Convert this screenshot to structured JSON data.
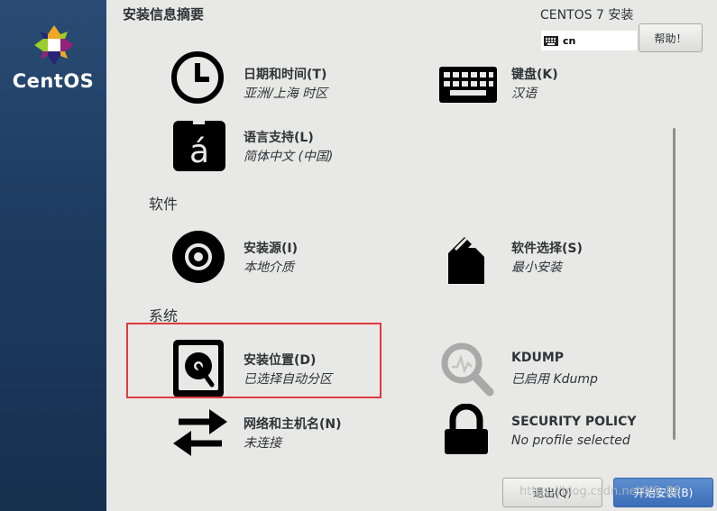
{
  "sidebar": {
    "brand": "CentOS"
  },
  "header": {
    "title": "安装信息摘要",
    "product": "CENTOS 7 安装",
    "keyboard_layout": "cn",
    "help_label": "帮助！"
  },
  "sections": {
    "software": "软件",
    "system": "系统"
  },
  "spokes": {
    "datetime": {
      "title": "日期和时间(T)",
      "status": "亚洲/上海 时区"
    },
    "keyboard": {
      "title": "键盘(K)",
      "status": "汉语"
    },
    "language": {
      "title": "语言支持(L)",
      "status": "简体中文 (中国)"
    },
    "source": {
      "title": "安装源(I)",
      "status": "本地介质"
    },
    "software": {
      "title": "软件选择(S)",
      "status": "最小安装"
    },
    "destination": {
      "title": "安装位置(D)",
      "status": "已选择自动分区"
    },
    "kdump": {
      "title": "KDUMP",
      "status": "已启用 Kdump"
    },
    "network": {
      "title": "网络和主机名(N)",
      "status": "未连接"
    },
    "security": {
      "title": "SECURITY POLICY",
      "status": "No profile selected"
    }
  },
  "footer": {
    "quit_label": "退出(Q)",
    "begin_label": "开始安装(B)"
  },
  "watermark": "https://blog.csdn.net/KS_88",
  "colors": {
    "sidebar": "#1f3e63",
    "accent": "#3b6db8",
    "highlight": "#e03a3a"
  }
}
